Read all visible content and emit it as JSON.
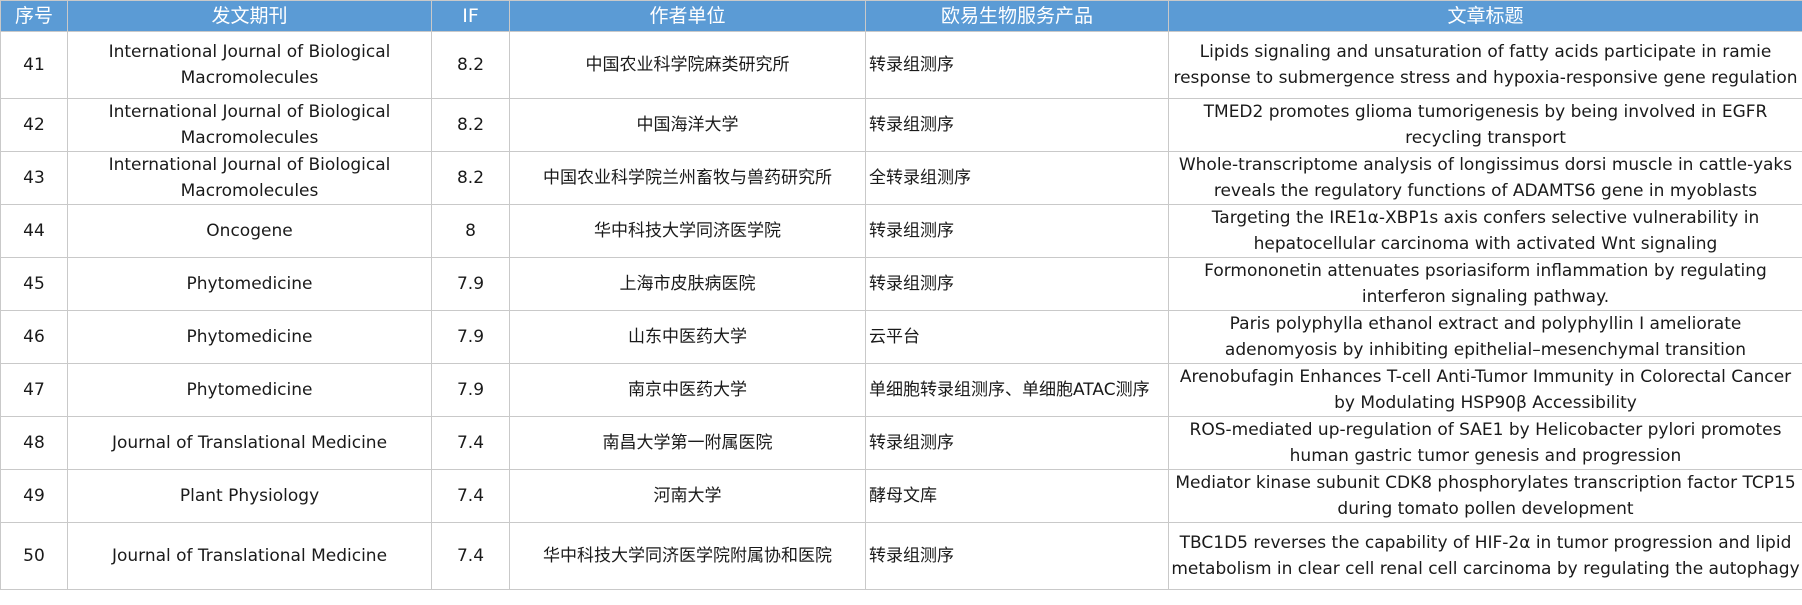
{
  "table": {
    "headers": [
      "序号",
      "发文期刊",
      "IF",
      "作者单位",
      "欧易生物服务产品",
      "文章标题"
    ],
    "rows": [
      {
        "no": "41",
        "journal": "International Journal of Biological Macromolecules",
        "if": "8.2",
        "institution": "中国农业科学院麻类研究所",
        "product": "转录组测序",
        "title": "Lipids signaling and unsaturation of fatty acids participate in ramie response to submergence stress and hypoxia-responsive gene regulation"
      },
      {
        "no": "42",
        "journal": "International Journal of Biological Macromolecules",
        "if": "8.2",
        "institution": "中国海洋大学",
        "product": "转录组测序",
        "title": "TMED2 promotes glioma tumorigenesis by being involved in EGFR recycling transport"
      },
      {
        "no": "43",
        "journal": "International Journal of Biological Macromolecules",
        "if": "8.2",
        "institution": "中国农业科学院兰州畜牧与兽药研究所",
        "product": "全转录组测序",
        "title": "Whole-transcriptome analysis of longissimus dorsi muscle in cattle-yaks reveals the regulatory functions of ADAMTS6 gene in myoblasts"
      },
      {
        "no": "44",
        "journal": "Oncogene",
        "if": "8",
        "institution": "华中科技大学同济医学院",
        "product": "转录组测序",
        "title": "Targeting the IRE1α-XBP1s axis confers selective vulnerability in hepatocellular carcinoma with activated Wnt signaling"
      },
      {
        "no": "45",
        "journal": "Phytomedicine",
        "if": "7.9",
        "institution": "上海市皮肤病医院",
        "product": "转录组测序",
        "title": "Formononetin attenuates psoriasiform inflammation by regulating interferon signaling pathway."
      },
      {
        "no": "46",
        "journal": "Phytomedicine",
        "if": "7.9",
        "institution": "山东中医药大学",
        "product": "云平台",
        "title": "Paris polyphylla ethanol extract and polyphyllin I ameliorate adenomyosis by inhibiting epithelial–mesenchymal transition"
      },
      {
        "no": "47",
        "journal": "Phytomedicine",
        "if": "7.9",
        "institution": "南京中医药大学",
        "product": "单细胞转录组测序、单细胞ATAC测序",
        "title": "Arenobufagin Enhances T-cell Anti-Tumor Immunity in Colorectal Cancer by Modulating HSP90β Accessibility"
      },
      {
        "no": "48",
        "journal": "Journal of Translational Medicine",
        "if": "7.4",
        "institution": "南昌大学第一附属医院",
        "product": "转录组测序",
        "title": "ROS-mediated up-regulation of SAE1 by Helicobacter pylori promotes human gastric tumor genesis and progression"
      },
      {
        "no": "49",
        "journal": "Plant Physiology",
        "if": "7.4",
        "institution": "河南大学",
        "product": "酵母文库",
        "title": "Mediator kinase subunit CDK8 phosphorylates transcription factor TCP15 during tomato pollen development"
      },
      {
        "no": "50",
        "journal": "Journal of Translational Medicine",
        "if": "7.4",
        "institution": "华中科技大学同济医学院附属协和医院",
        "product": "转录组测序",
        "title": "TBC1D5 reverses the capability of HIF-2α in tumor progression and lipid metabolism in clear cell renal cell carcinoma by regulating the autophagy"
      }
    ]
  },
  "colors": {
    "header_bg": "#5b9bd5",
    "header_text": "#ffffff",
    "grid": "#c9c9c9"
  }
}
